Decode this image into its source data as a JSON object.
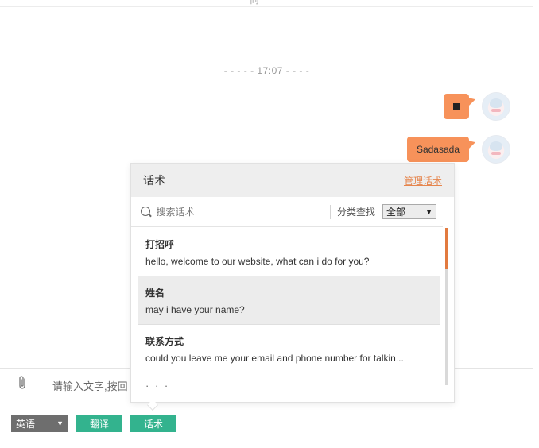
{
  "chat": {
    "top_cutoff_text": "同",
    "time_divider": "- - - - - 17:07 - - - -",
    "messages": [
      {
        "text": "■",
        "is_square": true
      },
      {
        "text": "Sadasada"
      }
    ]
  },
  "script_panel": {
    "title": "话术",
    "manage_link": "管理话术",
    "search_placeholder": "搜索话术",
    "category_label": "分类查找",
    "category_selected": "全部",
    "items": [
      {
        "name": "打招呼",
        "text": "hello, welcome to our website, what can i do for you?"
      },
      {
        "name": "姓名",
        "text": "may i have your name?"
      },
      {
        "name": "联系方式",
        "text": "could you leave me your email and phone number for talkin..."
      }
    ],
    "more": "· · ·"
  },
  "input": {
    "placeholder": "请输入文字,按回"
  },
  "toolbar": {
    "language_selected": "英语",
    "translate_label": "翻译",
    "script_label": "话术"
  },
  "colors": {
    "bubble": "#f7925a",
    "accent_green": "#33b38e",
    "manage_link": "#e6854d",
    "scroll_thumb": "#e27a3f"
  }
}
